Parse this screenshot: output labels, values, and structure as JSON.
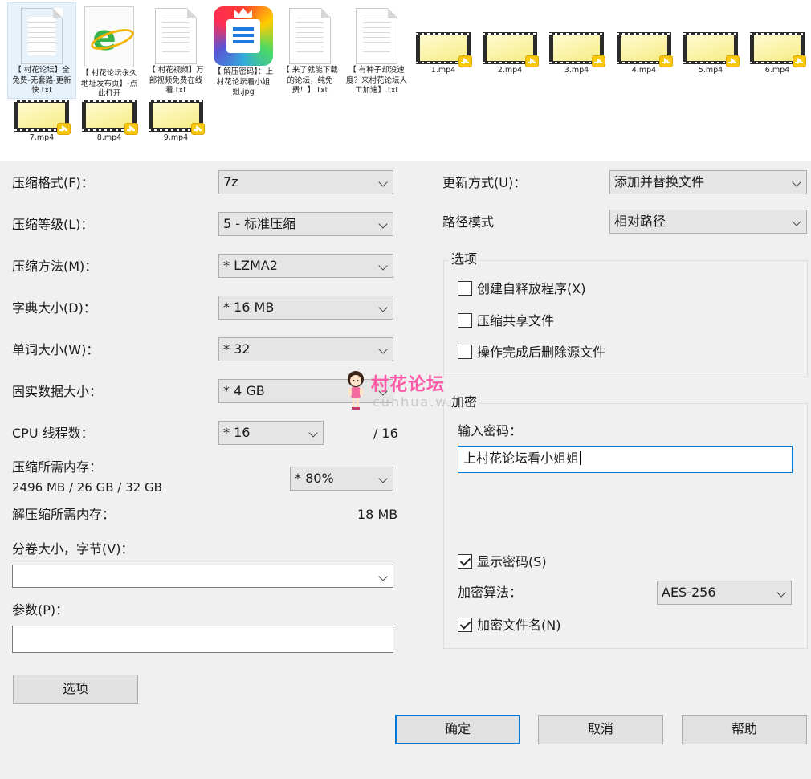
{
  "files": [
    {
      "name": "【 村花论坛】全免费-无套路-更新快.txt",
      "kind": "text-file",
      "selected": true
    },
    {
      "name": "【 村花论坛永久地址发布页】-点此打开",
      "kind": "browser-shortcut",
      "selected": false
    },
    {
      "name": "【 村花视频】万部视频免费在线看.txt",
      "kind": "text-file",
      "selected": false
    },
    {
      "name": "【 解压密码】：上村花论坛看小姐姐.jpg",
      "kind": "image-app",
      "selected": false
    },
    {
      "name": "【 来了就能下载的论坛，纯免费！】.txt",
      "kind": "text-file",
      "selected": false
    },
    {
      "name": "【 有种子却没速度？来村花论坛人工加速】.txt",
      "kind": "text-file",
      "selected": false
    },
    {
      "name": "1.mp4",
      "kind": "video-file",
      "selected": false
    },
    {
      "name": "2.mp4",
      "kind": "video-file",
      "selected": false
    },
    {
      "name": "3.mp4",
      "kind": "video-file",
      "selected": false
    },
    {
      "name": "4.mp4",
      "kind": "video-file",
      "selected": false
    },
    {
      "name": "5.mp4",
      "kind": "video-file",
      "selected": false
    },
    {
      "name": "6.mp4",
      "kind": "video-file",
      "selected": false
    },
    {
      "name": "7.mp4",
      "kind": "video-file",
      "selected": false
    },
    {
      "name": "8.mp4",
      "kind": "video-file",
      "selected": false
    },
    {
      "name": "9.mp4",
      "kind": "video-file",
      "selected": false
    }
  ],
  "left": {
    "format": {
      "label": "压缩格式(F)：",
      "value": "7z"
    },
    "level": {
      "label": "压缩等级(L)：",
      "value": "5 - 标准压缩"
    },
    "method": {
      "label": "压缩方法(M)：",
      "value": "* LZMA2"
    },
    "dict": {
      "label": "字典大小(D)：",
      "value": "* 16 MB"
    },
    "word": {
      "label": "单词大小(W)：",
      "value": "* 32"
    },
    "solid": {
      "label": "固实数据大小：",
      "value": "* 4 GB"
    },
    "threads": {
      "label": "CPU 线程数：",
      "value": "* 16",
      "max": "/ 16"
    },
    "memory": {
      "label": "压缩所需内存：",
      "detail": "2496 MB / 26 GB / 32 GB",
      "value": "* 80%"
    },
    "decompress": {
      "label": "解压缩所需内存：",
      "value": "18 MB"
    },
    "split": {
      "label": "分卷大小，字节(V)：",
      "value": ""
    },
    "params": {
      "label": "参数(P)：",
      "value": ""
    },
    "options_button": "选项"
  },
  "right": {
    "update": {
      "label": "更新方式(U)：",
      "value": "添加并替换文件"
    },
    "path": {
      "label": "路径模式",
      "value": "相对路径"
    },
    "options_group": {
      "title": "选项",
      "items": [
        {
          "label": "创建自释放程序(X)",
          "checked": false
        },
        {
          "label": "压缩共享文件",
          "checked": false
        },
        {
          "label": "操作完成后删除源文件",
          "checked": false
        }
      ]
    },
    "encryption": {
      "title": "加密",
      "password_label": "输入密码：",
      "password_value": "上村花论坛看小姐姐",
      "show_password": {
        "label": "显示密码(S)",
        "checked": true
      },
      "algorithm_label": "加密算法：",
      "algorithm_value": "AES-256",
      "encrypt_names": {
        "label": "加密文件名(N)",
        "checked": true
      }
    }
  },
  "buttons": {
    "ok": "确定",
    "cancel": "取消",
    "help": "帮助"
  },
  "watermark": {
    "title": "村花论坛",
    "subtitle": "cunhua.w..."
  },
  "colors": {
    "dialog_bg": "#f0f0f0",
    "focus_border": "#0078d7",
    "watermark": "#ff5aa8"
  }
}
